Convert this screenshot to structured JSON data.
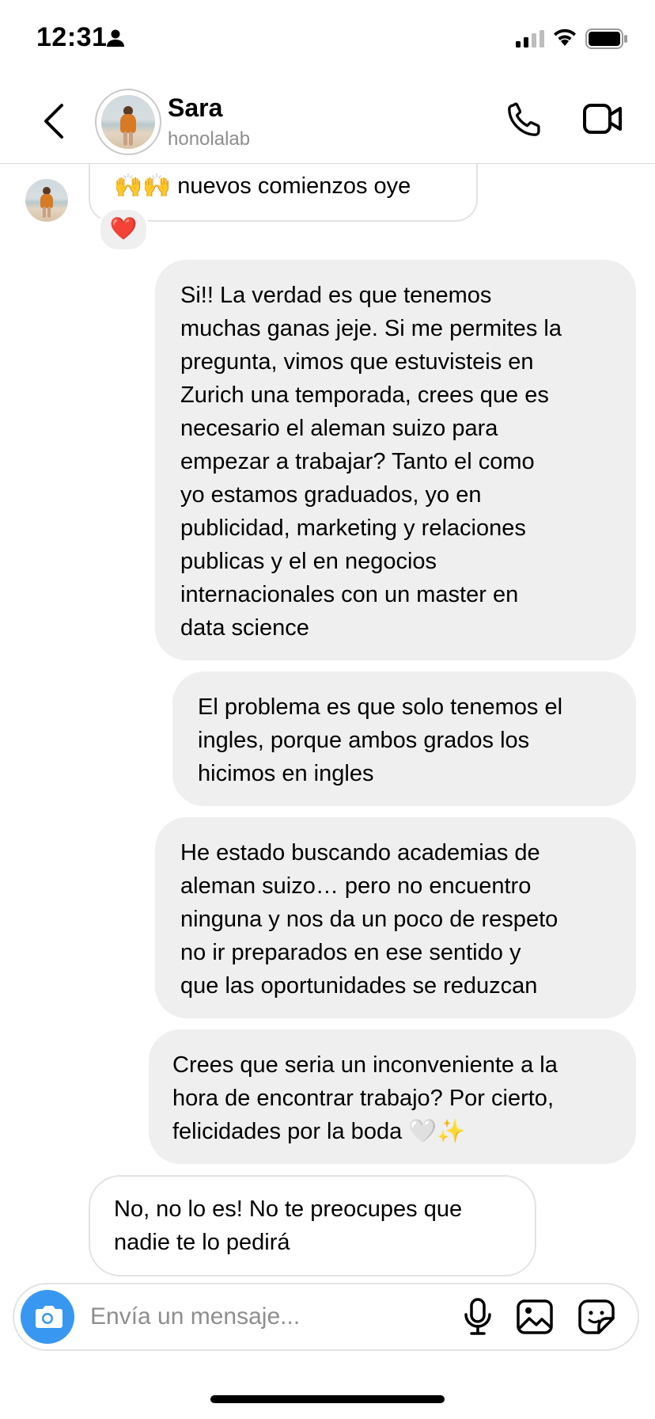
{
  "status_bar": {
    "time": "12:31"
  },
  "header": {
    "name": "Sara",
    "username": "honolalab"
  },
  "messages": [
    {
      "from": "them",
      "text": "🙌🙌 nuevos comienzos oye",
      "reaction": "❤️"
    },
    {
      "from": "me",
      "text": "Si!! La verdad es que tenemos\nmuchas ganas jeje. Si me permites la\npregunta, vimos que estuvisteis en\nZurich una temporada, crees que es\nnecesario el aleman suizo para\nempezar a trabajar? Tanto el como\nyo estamos graduados, yo en\npublicidad, marketing y relaciones\npublicas y el en negocios\ninternacionales con un master en\ndata science"
    },
    {
      "from": "me",
      "text": "El problema es que solo tenemos el\ningles, porque ambos grados los\nhicimos en ingles"
    },
    {
      "from": "me",
      "text": "He estado buscando academias de\naleman suizo… pero no encuentro\nninguna y nos da un poco de respeto\nno ir preparados en ese sentido y\nque las oportunidades se reduzcan"
    },
    {
      "from": "me",
      "text": "Crees que seria un inconveniente a la\nhora de encontrar trabajo? Por cierto,\nfelicidades por la boda 🤍✨"
    },
    {
      "from": "them",
      "text": "No, no lo es! No te preocupes que\nnadie te lo pedirá"
    }
  ],
  "composer": {
    "placeholder": "Envía un mensaje..."
  },
  "icons": {
    "back": "chevron-left-icon",
    "call": "phone-icon",
    "video": "video-camera-icon",
    "camera": "camera-icon",
    "mic": "microphone-icon",
    "gallery": "image-icon",
    "sticker": "sticker-icon"
  },
  "colors": {
    "accent": "#3897f0",
    "bubble_out": "#efefef",
    "bubble_in_border": "#e3e3e3",
    "secondary_text": "#8e8e8e"
  }
}
